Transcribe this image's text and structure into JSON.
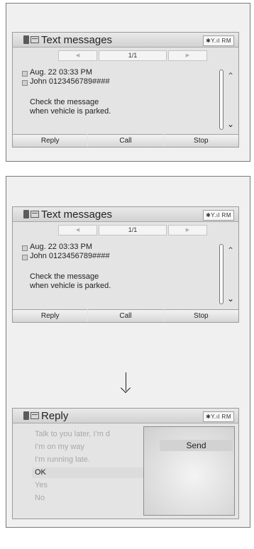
{
  "screen1": {
    "title": "Text messages",
    "status": "✱Y.ıl RM",
    "pager": {
      "prev": "◀",
      "page": "1/1",
      "next": "▶"
    },
    "date": "Aug. 22 03:33 PM",
    "sender": "John 0123456789####",
    "message_lines": [
      "Check the message",
      "when vehicle is parked."
    ],
    "buttons": [
      "Reply",
      "Call",
      "Stop"
    ]
  },
  "screen2": {
    "title": "Text messages",
    "status": "✱Y.ıl RM",
    "pager": {
      "prev": "◀",
      "page": "1/1",
      "next": "▶"
    },
    "date": "Aug. 22 03:33 PM",
    "sender": "John 0123456789####",
    "message_lines": [
      "Check the message",
      "when vehicle is parked."
    ],
    "buttons": [
      "Reply",
      "Call",
      "Stop"
    ]
  },
  "screen3": {
    "title": "Reply",
    "status": "✱Y.ıl RM",
    "replies": [
      "Talk to you later, I'm d",
      "I'm on my way",
      "I'm running late.",
      "OK",
      "Yes",
      "No"
    ],
    "send_label": "Send"
  },
  "icons": {
    "scroll_up": "⌃",
    "scroll_down": "⌄"
  }
}
